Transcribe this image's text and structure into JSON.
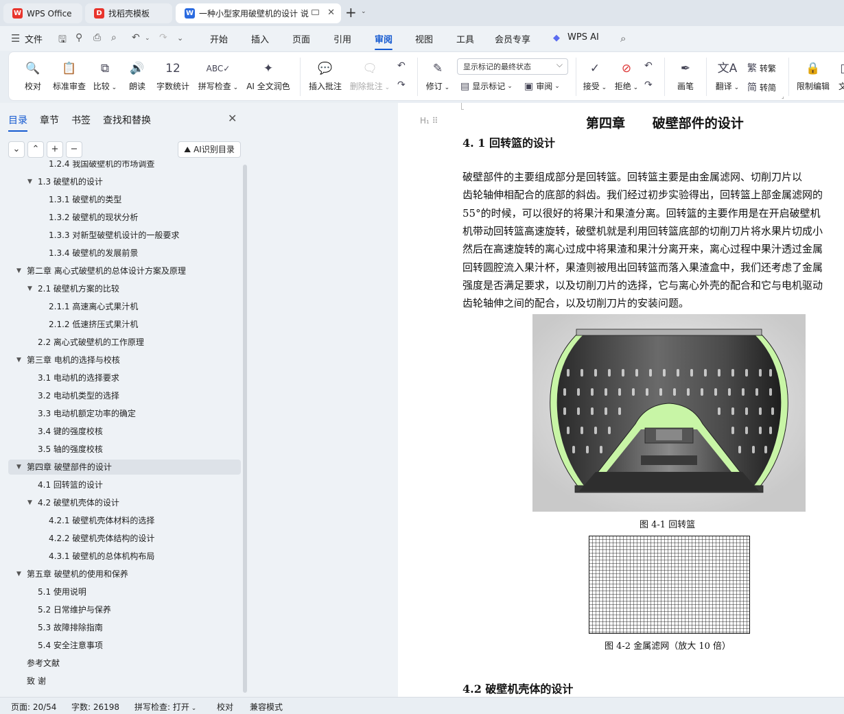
{
  "tabs": [
    {
      "label": "WPS Office",
      "icon": "wps-logo-icon"
    },
    {
      "label": "找稻壳模板",
      "icon": "docer-icon"
    },
    {
      "label": "一种小型家用破壁机的设计 说",
      "icon": "writer-doc-icon"
    }
  ],
  "menu": [
    "文件",
    "开始",
    "插入",
    "页面",
    "引用",
    "审阅",
    "视图",
    "工具",
    "会员专享",
    "WPS AI"
  ],
  "active_menu": "审阅",
  "ribbon": {
    "proofread": "校对",
    "standard_review": "标准审查",
    "compare": "比较",
    "read_aloud": "朗读",
    "word_count": "字数统计",
    "spell_check": "拼写检查",
    "ai_polish": "AI 全文润色",
    "insert_comment": "插入批注",
    "delete_comment": "删除批注",
    "track_changes": "修订",
    "markup_state": "显示标记的最终状态",
    "show_markup": "显示标记",
    "review_pane": "审阅",
    "accept": "接受",
    "reject": "拒绝",
    "pen": "画笔",
    "translate": "翻译",
    "to_traditional": "转繁",
    "to_simplified": "转简",
    "restrict_edit": "限制编辑",
    "doc_partial": "文"
  },
  "panel": {
    "tabs": [
      "目录",
      "章节",
      "书签",
      "查找和替换"
    ],
    "ai_toc": "AI识别目录",
    "toc": [
      {
        "text": "1.2.4 我国破壁机的市场调查",
        "level": 3
      },
      {
        "text": "1.3  破壁机的设计",
        "level": 2,
        "arrow": true
      },
      {
        "text": "1.3.1 破壁机的类型",
        "level": 3
      },
      {
        "text": "1.3.2  破壁机的现状分析",
        "level": 3
      },
      {
        "text": "1.3.3 对新型破壁机设计的一般要求",
        "level": 3
      },
      {
        "text": "1.3.4  破壁机的发展前景",
        "level": 3
      },
      {
        "text": "第二章  离心式破壁机的总体设计方案及原理",
        "level": 1,
        "arrow": true
      },
      {
        "text": "2.1  破壁机方案的比较",
        "level": 2,
        "arrow": true
      },
      {
        "text": "2.1.1 高速离心式果汁机",
        "level": 3
      },
      {
        "text": "2.1.2  低速挤压式果汁机",
        "level": 3
      },
      {
        "text": "2.2 离心式破壁机的工作原理",
        "level": 2
      },
      {
        "text": "第三章  电机的选择与校核",
        "level": 1,
        "arrow": true
      },
      {
        "text": "3.1  电动机的选择要求",
        "level": 2
      },
      {
        "text": "3.2  电动机类型的选择",
        "level": 2
      },
      {
        "text": "3.3  电动机额定功率的确定",
        "level": 2
      },
      {
        "text": "3.4  键的强度校核",
        "level": 2
      },
      {
        "text": "3.5  轴的强度校核",
        "level": 2
      },
      {
        "text": "第四章     破壁部件的设计",
        "level": 1,
        "arrow": true,
        "selected": true
      },
      {
        "text": "4.1  回转篮的设计",
        "level": 2
      },
      {
        "text": "4.2 破壁机壳体的设计",
        "level": 2,
        "arrow": true
      },
      {
        "text": "4.2.1  破壁机壳体材料的选择",
        "level": 3
      },
      {
        "text": "4.2.2 破壁机壳体结构的设计",
        "level": 3
      },
      {
        "text": "4.3.1 破壁机的总体机构布局",
        "level": 3
      },
      {
        "text": "第五章    破壁机的使用和保养",
        "level": 1,
        "arrow": true
      },
      {
        "text": "5.1  使用说明",
        "level": 2
      },
      {
        "text": "5.2  日常维护与保养",
        "level": 2
      },
      {
        "text": "5.3  故障排除指南",
        "level": 2
      },
      {
        "text": "5.4  安全注意事项",
        "level": 2
      },
      {
        "text": "参考文献",
        "level": 1
      },
      {
        "text": "致      谢",
        "level": 1
      }
    ]
  },
  "doc": {
    "heading_mark": "H₁",
    "chapter_title": "第四章      破壁部件的设计",
    "section_1": "4. 1  回转篮的设计",
    "paragraph_lines": [
      "        破壁部件的主要组成部分是回转篮。回转篮主要是由金属滤网、切削刀片以",
      "齿轮轴伸相配合的底部的斜齿。我们经过初步实验得出，回转篮上部金属滤网的",
      "55°的时候，可以很好的将果汁和果渣分离。回转篮的主要作用是在开启破壁机",
      "机带动回转篮高速旋转，破壁机就是利用回转篮底部的切削刀片将水果片切成小",
      "然后在高速旋转的离心过成中将果渣和果汁分离开来，离心过程中果汁透过金属",
      "回转圆腔流入果汁杯，果渣则被甩出回转篮而落入果渣盒中，我们还考虑了金属",
      "强度是否满足要求，以及切削刀片的选择，它与离心外壳的配合和它与电机驱动",
      "齿轮轴伸之间的配合，以及切削刀片的安装问题。"
    ],
    "figure1_caption": "图 4-1  回转篮",
    "figure2_caption": "图 4-2  金属滤网（放大 10 倍）",
    "section_2": "4.2 破壁机壳体的设计"
  },
  "status": {
    "page": "页面: 20/54",
    "words": "字数: 26198",
    "spell": "拼写检查: 打开",
    "proof": "校对",
    "compat": "兼容模式"
  },
  "colors": {
    "accent": "#1459d0",
    "figure_highlight": "#c8f5a6"
  }
}
